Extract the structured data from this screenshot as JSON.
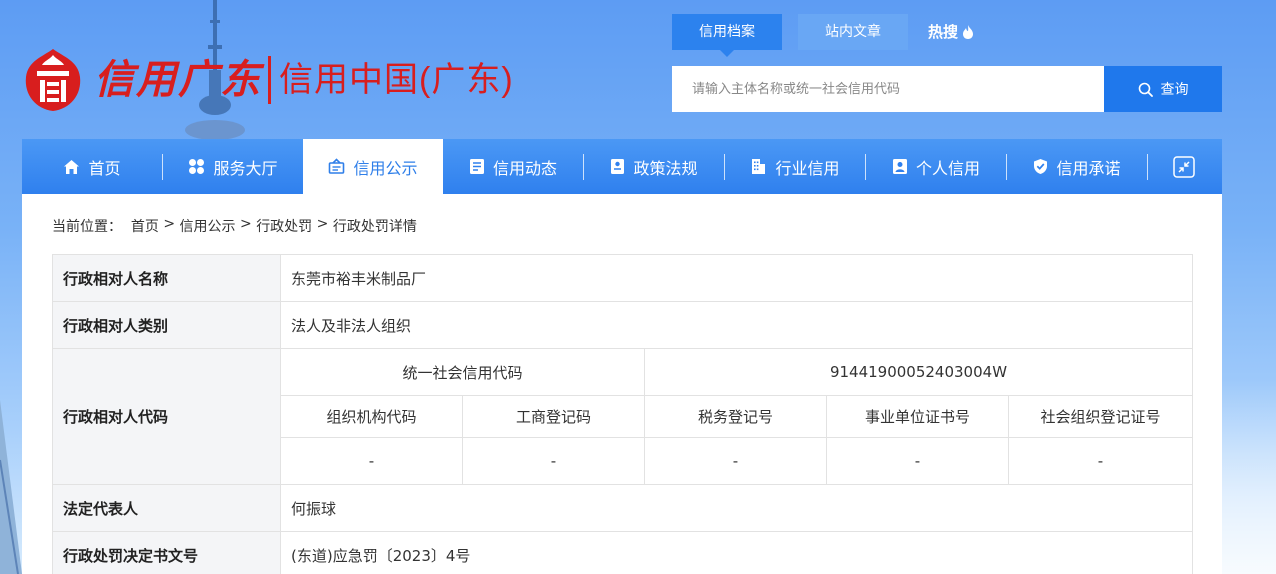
{
  "logo": {
    "calligraphy": "信用广东",
    "text": "信用中国(广东)"
  },
  "search": {
    "tabs": [
      {
        "label": "信用档案",
        "active": true
      },
      {
        "label": "站内文章",
        "active": false
      }
    ],
    "hot_label": "热搜",
    "hot_icon": "flame-icon",
    "placeholder": "请输入主体名称或统一社会信用代码",
    "button_label": "查询",
    "button_icon": "search-icon"
  },
  "nav": {
    "items": [
      {
        "label": "首页",
        "icon": "home-icon",
        "active": false
      },
      {
        "label": "服务大厅",
        "icon": "grid-icon",
        "active": false
      },
      {
        "label": "信用公示",
        "icon": "announcement-icon",
        "active": true
      },
      {
        "label": "信用动态",
        "icon": "news-icon",
        "active": false
      },
      {
        "label": "政策法规",
        "icon": "book-icon",
        "active": false
      },
      {
        "label": "行业信用",
        "icon": "building-icon",
        "active": false
      },
      {
        "label": "个人信用",
        "icon": "id-card-icon",
        "active": false
      },
      {
        "label": "信用承诺",
        "icon": "shield-check-icon",
        "active": false
      }
    ],
    "expand_icon": "collapse-icon"
  },
  "breadcrumb": {
    "prefix": "当前位置：",
    "items": [
      "首页",
      "信用公示",
      "行政处罚",
      "行政处罚详情"
    ],
    "separator": " > "
  },
  "detail": {
    "name_label": "行政相对人名称",
    "name_value": "东莞市裕丰米制品厂",
    "category_label": "行政相对人类别",
    "category_value": "法人及非法人组织",
    "code_label": "行政相对人代码",
    "uscc_label": "统一社会信用代码",
    "uscc_value": "91441900052403004W",
    "code_headers": [
      "组织机构代码",
      "工商登记码",
      "税务登记号",
      "事业单位证书号",
      "社会组织登记证号"
    ],
    "code_values": [
      "-",
      "-",
      "-",
      "-",
      "-"
    ],
    "legal_rep_label": "法定代表人",
    "legal_rep_value": "何振球",
    "decision_no_label": "行政处罚决定书文号",
    "decision_no_value": "(东道)应急罚〔2023〕4号"
  },
  "colors": {
    "nav_bg": "#2f80ee",
    "logo_red": "#d81e1e",
    "search_button": "#1f78ec",
    "active_text": "#2f7fe9"
  }
}
